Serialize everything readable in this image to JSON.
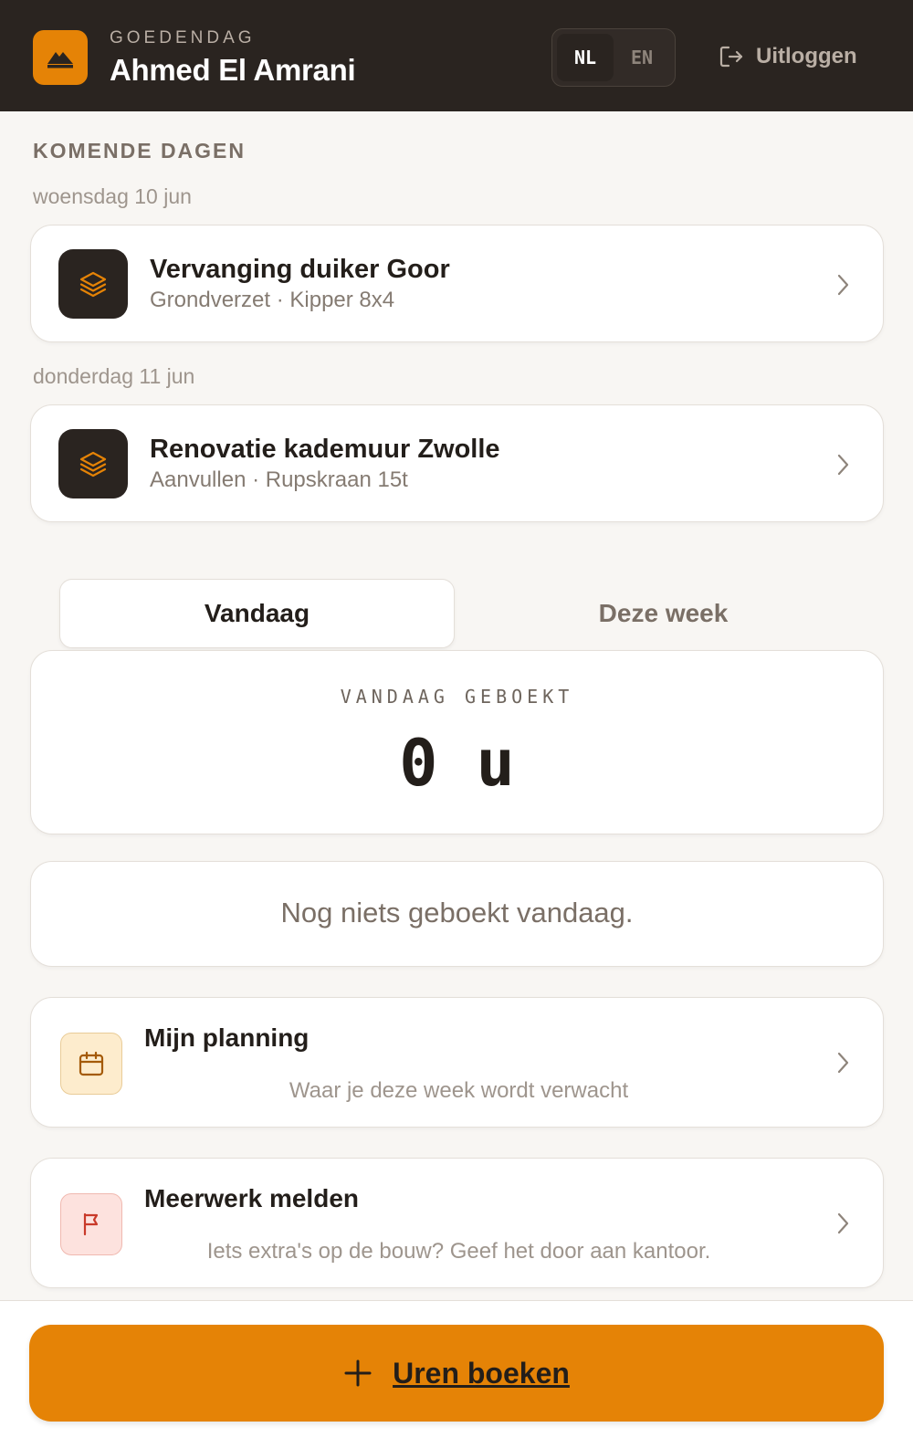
{
  "header": {
    "greeting": "GOEDENDAG",
    "user_name": "Ahmed El Amrani",
    "languages": [
      {
        "code": "NL",
        "active": true
      },
      {
        "code": "EN",
        "active": false
      }
    ],
    "logout_label": "Uitloggen"
  },
  "upcoming": {
    "title": "KOMENDE DAGEN",
    "days": [
      {
        "date": "woensdag 10 jun",
        "job_title": "Vervanging duiker Goor",
        "job_sub": "Grondverzet · Kipper 8x4"
      },
      {
        "date": "donderdag 11 jun",
        "job_title": "Renovatie kademuur Zwolle",
        "job_sub": "Aanvullen · Rupskraan 15t"
      }
    ]
  },
  "tabs": [
    {
      "label": "Vandaag",
      "active": true
    },
    {
      "label": "Deze week",
      "active": false
    }
  ],
  "booked": {
    "label": "VANDAAG GEBOEKT",
    "value": "0 u"
  },
  "empty_state": "Nog niets geboekt vandaag.",
  "actions": [
    {
      "title": "Mijn planning",
      "subtitle": "Waar je deze week wordt verwacht",
      "icon": "calendar-icon"
    },
    {
      "title": "Meerwerk melden",
      "subtitle": "Iets extra's op de bouw? Geef het door aan kantoor.",
      "icon": "flag-icon"
    }
  ],
  "footer": {
    "book_label": "Uren boeken"
  },
  "colors": {
    "brand_orange": "#e58306",
    "header_dark": "#2a2420",
    "background": "#f8f6f3"
  }
}
